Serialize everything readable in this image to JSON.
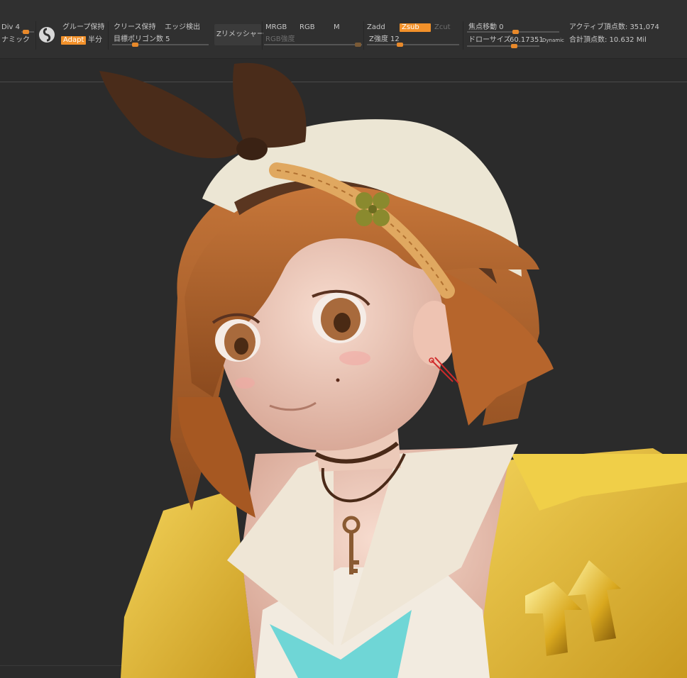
{
  "toolbar": {
    "div_label": "Div 4",
    "dynamic_label": "ナミック",
    "group_keep": "グループ保持",
    "adapt": "Adapt",
    "half": "半分",
    "crease_keep": "クリース保持",
    "edge_detect": "エッジ検出",
    "target_poly": "目標ポリゴン数 5",
    "zremesher": "Zリメッシャー",
    "mrgb": "MRGB",
    "rgb": "RGB",
    "m": "M",
    "rgb_intensity": "RGB強度",
    "zadd": "Zadd",
    "zsub": "Zsub",
    "zcut": "Zcut",
    "z_intensity": "Z強度 12",
    "focal_shift": "焦点移動 0",
    "draw_size_label": "ドローサイズ",
    "draw_size_value": "60.17351",
    "dynamic": "Dynamic",
    "active_points": "アクティブ頂点数: 351,074",
    "total_points": "合計頂点数: 10.632 Mil"
  },
  "colors": {
    "accent": "#f2912a",
    "toolbar_bg": "#303030",
    "viewport_bg": "#2b2b2b",
    "jacket": "#e8bf3a",
    "hair": "#b8652a",
    "skin": "#f0d0c0"
  },
  "icons": {
    "zbrush_logo": "zbrush-logo-icon"
  },
  "viewport": {
    "subject": "sculpted anime girl bust"
  }
}
